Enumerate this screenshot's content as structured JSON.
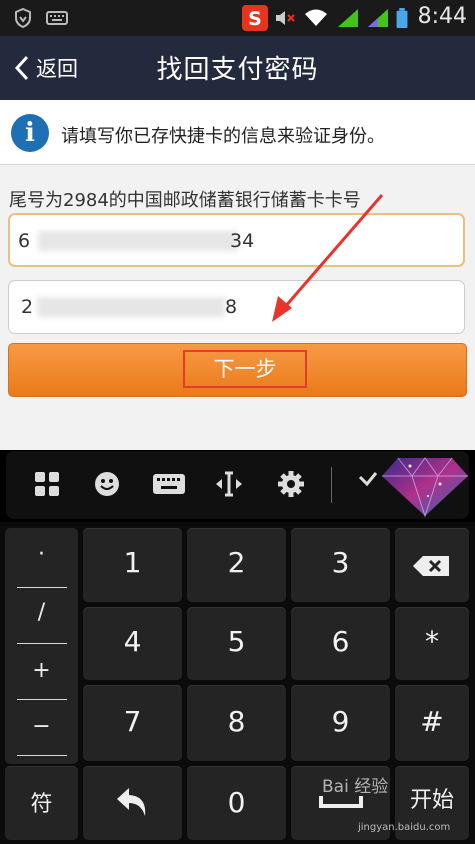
{
  "status_bar": {
    "time": "8:44",
    "icons": [
      "shield-icon",
      "keyboard-icon",
      "sogou-icon",
      "mute-icon",
      "wifi-icon",
      "signal-icon",
      "signal-icon",
      "battery-icon"
    ]
  },
  "header": {
    "back_label": "返回",
    "title": "找回支付密码"
  },
  "notice": {
    "text": "请填写你已存快捷卡的信息来验证身份。"
  },
  "form": {
    "card_label": "尾号为2984的中国邮政储蓄银行储蓄卡卡号",
    "card_number_visible_prefix": "6",
    "card_number_visible_suffix": "34",
    "id_number_visible_prefix": "2",
    "id_number_visible_suffix": "8",
    "next_label": "下一步"
  },
  "ime_toolbar": {
    "buttons": [
      "apps-grid-icon",
      "emoji-icon",
      "keyboard-icon",
      "cursor-icon",
      "settings-icon",
      "collapse-check-icon",
      "diamond-skin-icon"
    ]
  },
  "keyboard": {
    "symbols": [
      "·",
      "/",
      "+",
      "−"
    ],
    "digits": [
      "1",
      "2",
      "3",
      "4",
      "5",
      "6",
      "7",
      "8",
      "9",
      "0"
    ],
    "star": "*",
    "hash": "#",
    "sym_key": "符",
    "start_key": "开始"
  },
  "watermark": {
    "brand": "Bai 经验",
    "url": "jingyan.baidu.com"
  },
  "colors": {
    "header_bg": "#232a3e",
    "accent_orange": "#f08a30",
    "highlight_red": "#e53b2a",
    "info_blue": "#1e6fb4"
  }
}
